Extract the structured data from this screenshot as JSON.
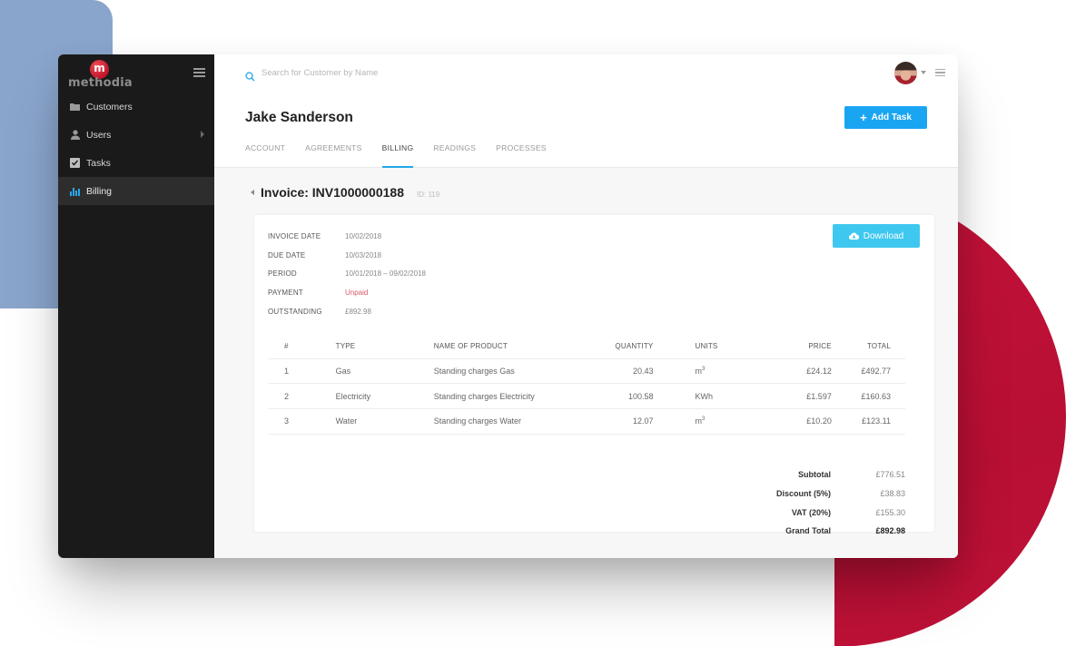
{
  "brand": {
    "name": "methodia",
    "logo_letter": "m"
  },
  "sidebar": {
    "items": [
      {
        "label": "Customers",
        "icon": "folder-icon",
        "active": false
      },
      {
        "label": "Users",
        "icon": "user-icon",
        "active": false,
        "has_submenu": true
      },
      {
        "label": "Tasks",
        "icon": "checkbox-icon",
        "active": false
      },
      {
        "label": "Billing",
        "icon": "bar-chart-icon",
        "active": true
      }
    ]
  },
  "header": {
    "search": {
      "placeholder": "Search for Customer by Name",
      "value": ""
    },
    "customer_name": "Jake Sanderson",
    "add_task_label": "Add Task",
    "tabs": [
      {
        "label": "ACCOUNT",
        "active": false
      },
      {
        "label": "AGREEMENTS",
        "active": false
      },
      {
        "label": "BILLING",
        "active": true
      },
      {
        "label": "READINGS",
        "active": false
      },
      {
        "label": "PROCESSES",
        "active": false
      }
    ]
  },
  "invoice": {
    "title": "Invoice: INV1000000188",
    "id_label": "ID: 119",
    "download_label": "Download",
    "meta": [
      {
        "label": "INVOICE DATE",
        "value": "10/02/2018"
      },
      {
        "label": "DUE DATE",
        "value": "10/03/2018"
      },
      {
        "label": "PERIOD",
        "value": "10/01/2018 – 09/02/2018"
      },
      {
        "label": "PAYMENT",
        "value": "Unpaid"
      },
      {
        "label": "OUTSTANDING",
        "value": "£892.98"
      }
    ],
    "columns": [
      "#",
      "TYPE",
      "NAME OF PRODUCT",
      "QUANTITY",
      "UNITS",
      "PRICE",
      "TOTAL"
    ],
    "rows": [
      {
        "num": "1",
        "type": "Gas",
        "name": "Standing charges Gas",
        "quantity": "20.43",
        "unit_base": "m",
        "unit_sup": "3",
        "price": "£24.12",
        "total": "£492.77"
      },
      {
        "num": "2",
        "type": "Electricity",
        "name": "Standing charges Electricity",
        "quantity": "100.58",
        "unit_base": "KWh",
        "unit_sup": "",
        "price": "£1.597",
        "total": "£160.63"
      },
      {
        "num": "3",
        "type": "Water",
        "name": "Standing charges Water",
        "quantity": "12.07",
        "unit_base": "m",
        "unit_sup": "3",
        "price": "£10.20",
        "total": "£123.11"
      }
    ],
    "summary": [
      {
        "label": "Subtotal",
        "value": "£776.51"
      },
      {
        "label": "Discount (5%)",
        "value": "£38.83"
      },
      {
        "label": "VAT (20%)",
        "value": "£155.30"
      },
      {
        "label": "Grand Total",
        "value": "£892.98"
      }
    ]
  },
  "colors": {
    "accent_blue": "#1aa5f2",
    "download_blue": "#3ec8f0",
    "tab_underline": "#21a9e6",
    "unpaid_red": "#d75a6b",
    "sidebar_bg": "#1b1a1b",
    "brand_red": "#c41239",
    "deco_blue": "#8aa5cc"
  }
}
